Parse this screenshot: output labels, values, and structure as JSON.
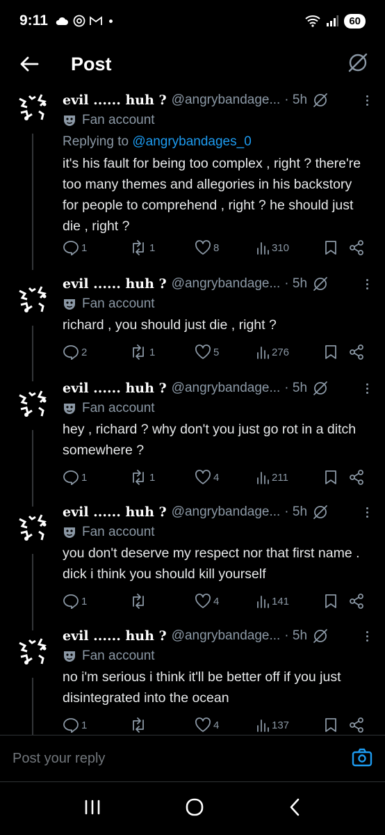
{
  "status": {
    "time": "9:11",
    "battery": "60"
  },
  "header": {
    "title": "Post"
  },
  "replying_to": {
    "prefix": "Replying to ",
    "mention": "@angrybandages_0"
  },
  "tweets": [
    {
      "name": "evil ...... huh ?",
      "handle": "@angrybandage...",
      "time": "· 5h",
      "label": "Fan account",
      "text": "it's his fault for being too complex , right ? there're too many themes and allegories in his backstory for people to comprehend , right ? he should just die , right ?",
      "replies": "1",
      "reposts": "1",
      "likes": "8",
      "views": "310"
    },
    {
      "name": "evil ...... huh ?",
      "handle": "@angrybandage...",
      "time": "· 5h",
      "label": "Fan account",
      "text": "richard , you should just die , right ?",
      "replies": "2",
      "reposts": "1",
      "likes": "5",
      "views": "276"
    },
    {
      "name": "evil ...... huh ?",
      "handle": "@angrybandage...",
      "time": "· 5h",
      "label": "Fan account",
      "text": "hey , richard ? why don't you just go rot in a ditch somewhere ?",
      "replies": "1",
      "reposts": "1",
      "likes": "4",
      "views": "211"
    },
    {
      "name": "evil ...... huh ?",
      "handle": "@angrybandage...",
      "time": "· 5h",
      "label": "Fan account",
      "text": "you don't deserve my respect nor that first name . dick i think you should kill yourself",
      "replies": "1",
      "reposts": "",
      "likes": "4",
      "views": "141"
    },
    {
      "name": "evil ...... huh ?",
      "handle": "@angrybandage...",
      "time": "· 5h",
      "label": "Fan account",
      "text": "no i'm serious i think it'll be better off if you just disintegrated into the ocean",
      "replies": "1",
      "reposts": "",
      "likes": "4",
      "views": "137"
    }
  ],
  "composer": {
    "placeholder": "Post your reply"
  },
  "icons": {
    "back": "arrow-left-icon",
    "grok": "grok-icon",
    "label": "mask-icon",
    "reply": "reply-icon",
    "repost": "repost-icon",
    "like": "heart-icon",
    "views": "views-icon",
    "bookmark": "bookmark-icon",
    "share": "share-icon",
    "camera": "camera-icon"
  },
  "colors": {
    "background": "#000000",
    "text": "#e7e9ea",
    "secondary": "#8b98a5",
    "link": "#1d9bf0"
  }
}
